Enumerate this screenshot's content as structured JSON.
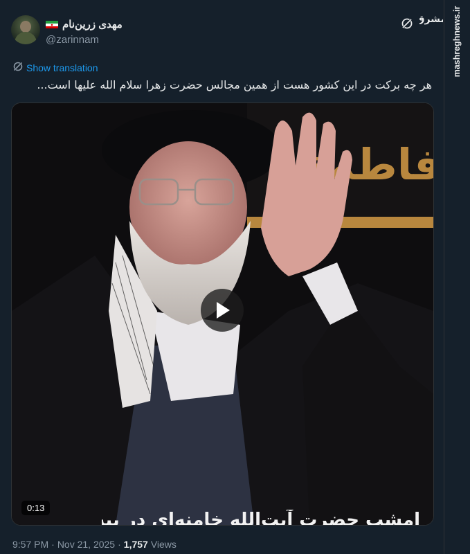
{
  "author": {
    "display_name": "مهدی زرین‌نام",
    "handle": "@zarinnam"
  },
  "source": {
    "site_url": "mashreghnews.ir",
    "logo_text": "مشرق"
  },
  "translation": {
    "label": "Show translation"
  },
  "tweet": {
    "text": "هر چه برکت در این کشور هست از همین مجالس حضرت زهرا سلام الله علیها است..."
  },
  "media": {
    "duration": "0:13",
    "subtitle": "امشب حضرت آیت‌الله خامنه‌ای در بیت رهبری",
    "banner_text": "فاطمة"
  },
  "meta": {
    "time": "9:57 PM",
    "separator": "·",
    "date": "Nov 21, 2025",
    "views_count": "1,757",
    "views_label": "Views"
  },
  "colors": {
    "background": "#15202b",
    "link": "#1d9bf0",
    "secondary_text": "#8b98a5",
    "banner_gold": "#b8873e"
  },
  "icons": [
    "grok-icon",
    "translate-icon",
    "play-icon",
    "iran-flag-icon"
  ]
}
